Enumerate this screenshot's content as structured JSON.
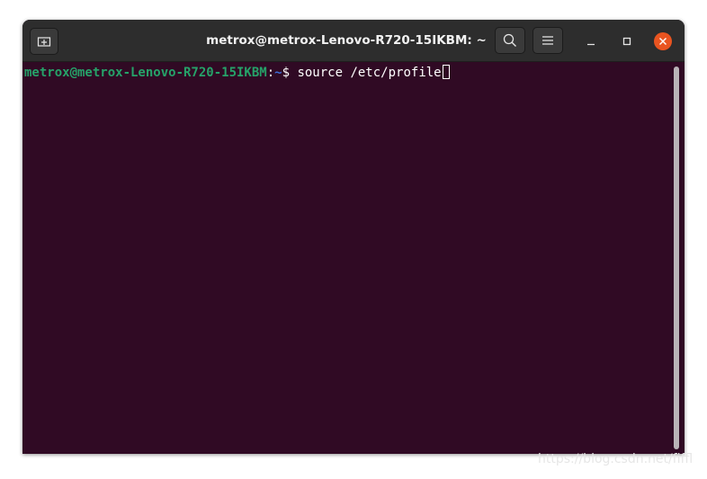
{
  "window": {
    "title": "metrox@metrox-Lenovo-R720-15IKBM: ~"
  },
  "titlebar": {
    "new_tab_icon": "new-tab-icon",
    "search_icon": "search-icon",
    "menu_icon": "hamburger-menu-icon",
    "minimize_icon": "minimize-icon",
    "maximize_icon": "maximize-icon",
    "close_icon": "close-icon"
  },
  "terminal": {
    "user_host": "metrox@metrox-Lenovo-R720-15IKBM",
    "colon": ":",
    "path": "~",
    "prompt_symbol": "$ ",
    "command": "source /etc/profile"
  },
  "watermark": {
    "text": "https://blog.csdn.net/fiffl"
  },
  "colors": {
    "terminal_bg": "#300a24",
    "titlebar_bg": "#2d2d2d",
    "user_host": "#26a269",
    "path": "#3f6fd8",
    "close_button": "#e95420"
  }
}
